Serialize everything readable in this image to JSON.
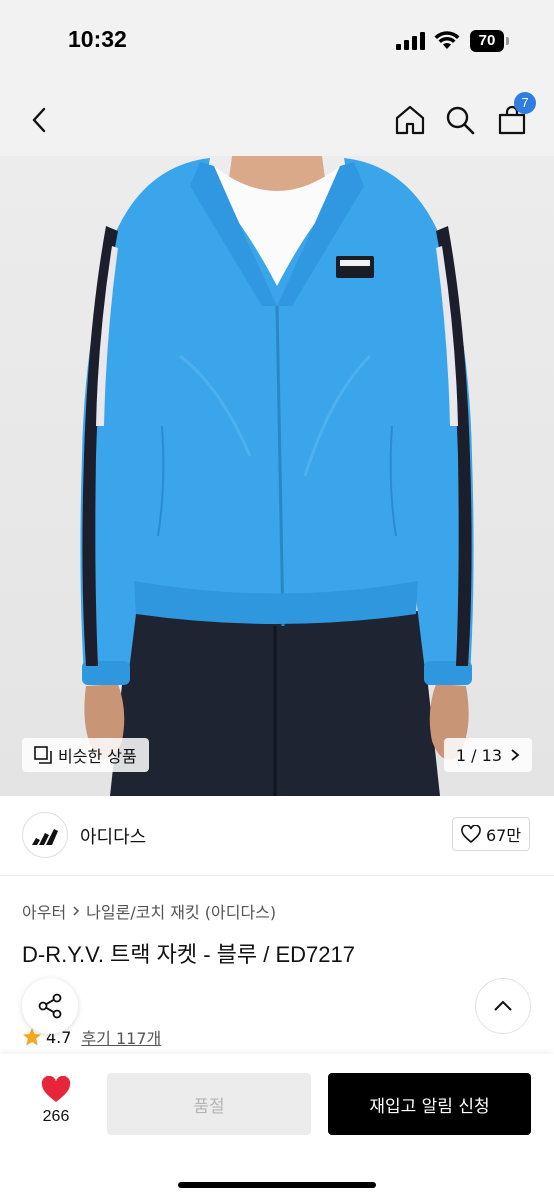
{
  "status_bar": {
    "time": "10:32",
    "battery": "70"
  },
  "nav": {
    "cart_count": "7"
  },
  "gallery": {
    "similar_label": "비슷한 상품",
    "pager": "1 / 13"
  },
  "brand": {
    "name": "아디다스",
    "likes": "67만"
  },
  "product": {
    "category_parent": "아우터",
    "category_child": "나일론/코치 재킷 (아디다스)",
    "title": "D-R.Y.V. 트랙 자켓 - 블루 / ED7217",
    "rating": "4.7",
    "reviews": "후기 117개"
  },
  "actions": {
    "wish_count": "266",
    "soldout_label": "품절",
    "restock_label": "재입고 알림 신청"
  },
  "colors": {
    "jacket": "#3aa5ea",
    "accent": "#2f7de1",
    "heart": "#e8253a",
    "star": "#f5a623"
  },
  "icons": [
    "back-icon",
    "home-icon",
    "search-icon",
    "cart-icon",
    "similar-icon",
    "chevron-right-icon",
    "adidas-logo-icon",
    "heart-outline-icon",
    "share-icon",
    "chevron-up-icon",
    "star-icon",
    "heart-filled-icon"
  ]
}
